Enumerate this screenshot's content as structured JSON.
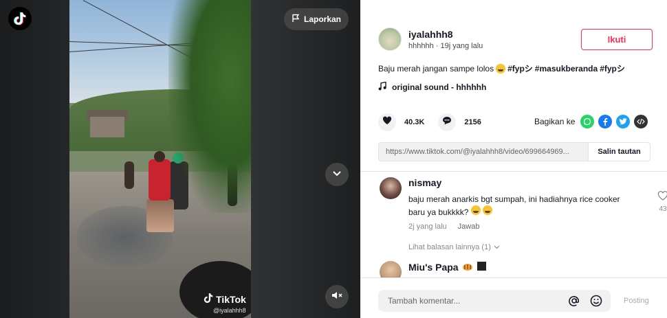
{
  "video": {
    "report_label": "Laporkan",
    "watermark_brand": "TikTok",
    "watermark_user": "@iyalahhh8"
  },
  "author": {
    "username": "iyalahhh8",
    "display_name": "hhhhhh",
    "separator": "·",
    "posted": "19j yang lalu",
    "follow_label": "Ikuti"
  },
  "caption": {
    "text": "Baju merah jangan sampe lolos",
    "tags": [
      "#fypシ",
      "#masukberanda",
      "#fypシ"
    ]
  },
  "sound": {
    "label": "original sound - hhhhhh"
  },
  "stats": {
    "likes": "40.3K",
    "comments": "2156"
  },
  "share": {
    "label": "Bagikan ke",
    "colors": {
      "whatsapp": "#25d366",
      "facebook": "#1877f2",
      "twitter": "#1da1f2",
      "embed": "#333333"
    }
  },
  "link": {
    "url": "https://www.tiktok.com/@iyalahhh8/video/699664969...",
    "copy_label": "Salin tautan"
  },
  "comments": [
    {
      "name": "nismay",
      "text": "baju merah anarkis bgt sumpah, ini hadiahnya rice cooker baru ya bukkkk?",
      "time": "2j yang lalu",
      "reply_label": "Jawab",
      "likes": "43",
      "more_replies": "Lihat balasan lainnya (1)"
    },
    {
      "name": "Miu's Papa"
    }
  ],
  "footer": {
    "placeholder": "Tambah komentar...",
    "post_label": "Posting"
  },
  "colors": {
    "accent": "#fe2c55",
    "text": "#161823"
  }
}
